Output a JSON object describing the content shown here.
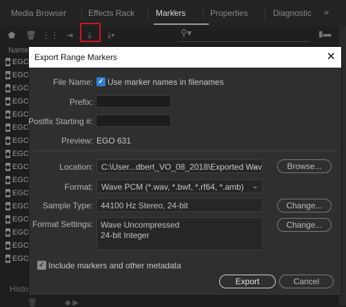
{
  "panel": {
    "tabs": [
      "Media Browser",
      "Effects Rack",
      "Markers",
      "Properties",
      "Diagnostic"
    ],
    "active_tab": "Markers",
    "overflow": "»",
    "column_header": "Name",
    "marker_label": "EGO",
    "bottom_tab": "Histo"
  },
  "dialog": {
    "title": "Export Range Markers",
    "close": "✕",
    "file_name_label": "File Name:",
    "use_marker_names_label": "Use marker names in filenames",
    "use_marker_names_checked": true,
    "prefix_label": "Prefix:",
    "prefix_value": "",
    "postfix_label": "Postfix Starting #:",
    "postfix_value": "",
    "preview_label": "Preview:",
    "preview_value": "EGO 631",
    "location_label": "Location:",
    "location_value": "C:\\User...dbert_VO_08_2018\\Exported Wavs",
    "browse_button": "Browse...",
    "format_label": "Format:",
    "format_value": "Wave PCM (*.wav, *.bwf, *.rf64, *.amb)",
    "sample_type_label": "Sample Type:",
    "sample_type_value": "44100 Hz Stereo, 24-bit",
    "change_button_1": "Change...",
    "format_settings_label": "Format Settings:",
    "format_settings_line1": "Wave Uncompressed",
    "format_settings_line2": "24-bit Integer",
    "change_button_2": "Change...",
    "include_metadata_label": "Include markers and other metadata",
    "include_metadata_checked": true,
    "export_button": "Export",
    "cancel_button": "Cancel"
  }
}
